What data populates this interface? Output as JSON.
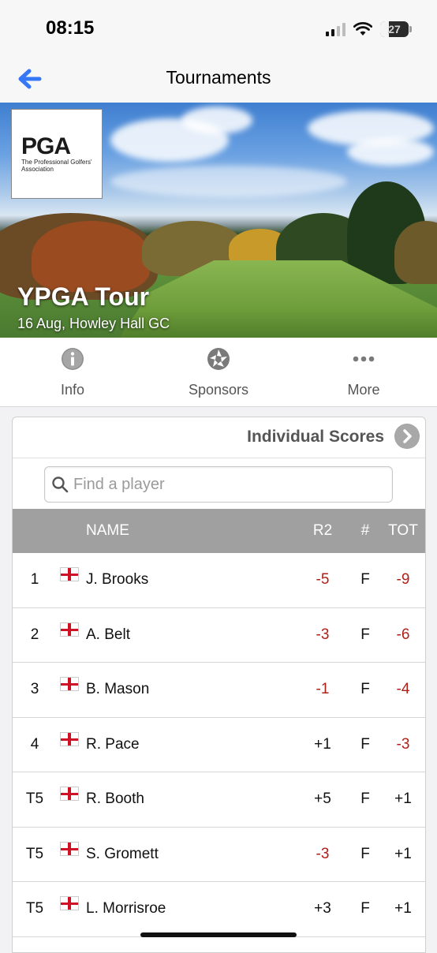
{
  "status_bar": {
    "time": "08:15",
    "battery": "27",
    "battery_level_percent": 27,
    "icons": [
      "signal-icon",
      "wifi-icon",
      "battery-icon"
    ]
  },
  "nav": {
    "title": "Tournaments",
    "back_icon": "back-arrow-icon",
    "accent_color": "#3478f6"
  },
  "hero": {
    "logo_text": "PGA",
    "logo_subtext": "The Professional Golfers' Association",
    "title": "YPGA Tour",
    "subtitle": "16 Aug, Howley Hall GC"
  },
  "tabs": [
    {
      "label": "Info",
      "icon": "info-icon"
    },
    {
      "label": "Sponsors",
      "icon": "aperture-icon"
    },
    {
      "label": "More",
      "icon": "more-dots-icon"
    }
  ],
  "scores": {
    "header_title": "Individual Scores",
    "search_placeholder": "Find a player",
    "search_value": "",
    "columns": {
      "pos": "",
      "name": "NAME",
      "r2": "R2",
      "thru": "#",
      "tot": "TOT"
    },
    "negative_color": "#b01f17",
    "rows": [
      {
        "pos": "1",
        "flag": "england-flag",
        "name": "J. Brooks",
        "r2": "-5",
        "thru": "F",
        "tot": "-9"
      },
      {
        "pos": "2",
        "flag": "england-flag",
        "name": "A. Belt",
        "r2": "-3",
        "thru": "F",
        "tot": "-6"
      },
      {
        "pos": "3",
        "flag": "england-flag",
        "name": "B. Mason",
        "r2": "-1",
        "thru": "F",
        "tot": "-4"
      },
      {
        "pos": "4",
        "flag": "england-flag",
        "name": "R. Pace",
        "r2": "+1",
        "thru": "F",
        "tot": "-3"
      },
      {
        "pos": "T5",
        "flag": "england-flag",
        "name": "R. Booth",
        "r2": "+5",
        "thru": "F",
        "tot": "+1"
      },
      {
        "pos": "T5",
        "flag": "england-flag",
        "name": "S. Gromett",
        "r2": "-3",
        "thru": "F",
        "tot": "+1"
      },
      {
        "pos": "T5",
        "flag": "england-flag",
        "name": "L. Morrisroe",
        "r2": "+3",
        "thru": "F",
        "tot": "+1"
      }
    ]
  }
}
